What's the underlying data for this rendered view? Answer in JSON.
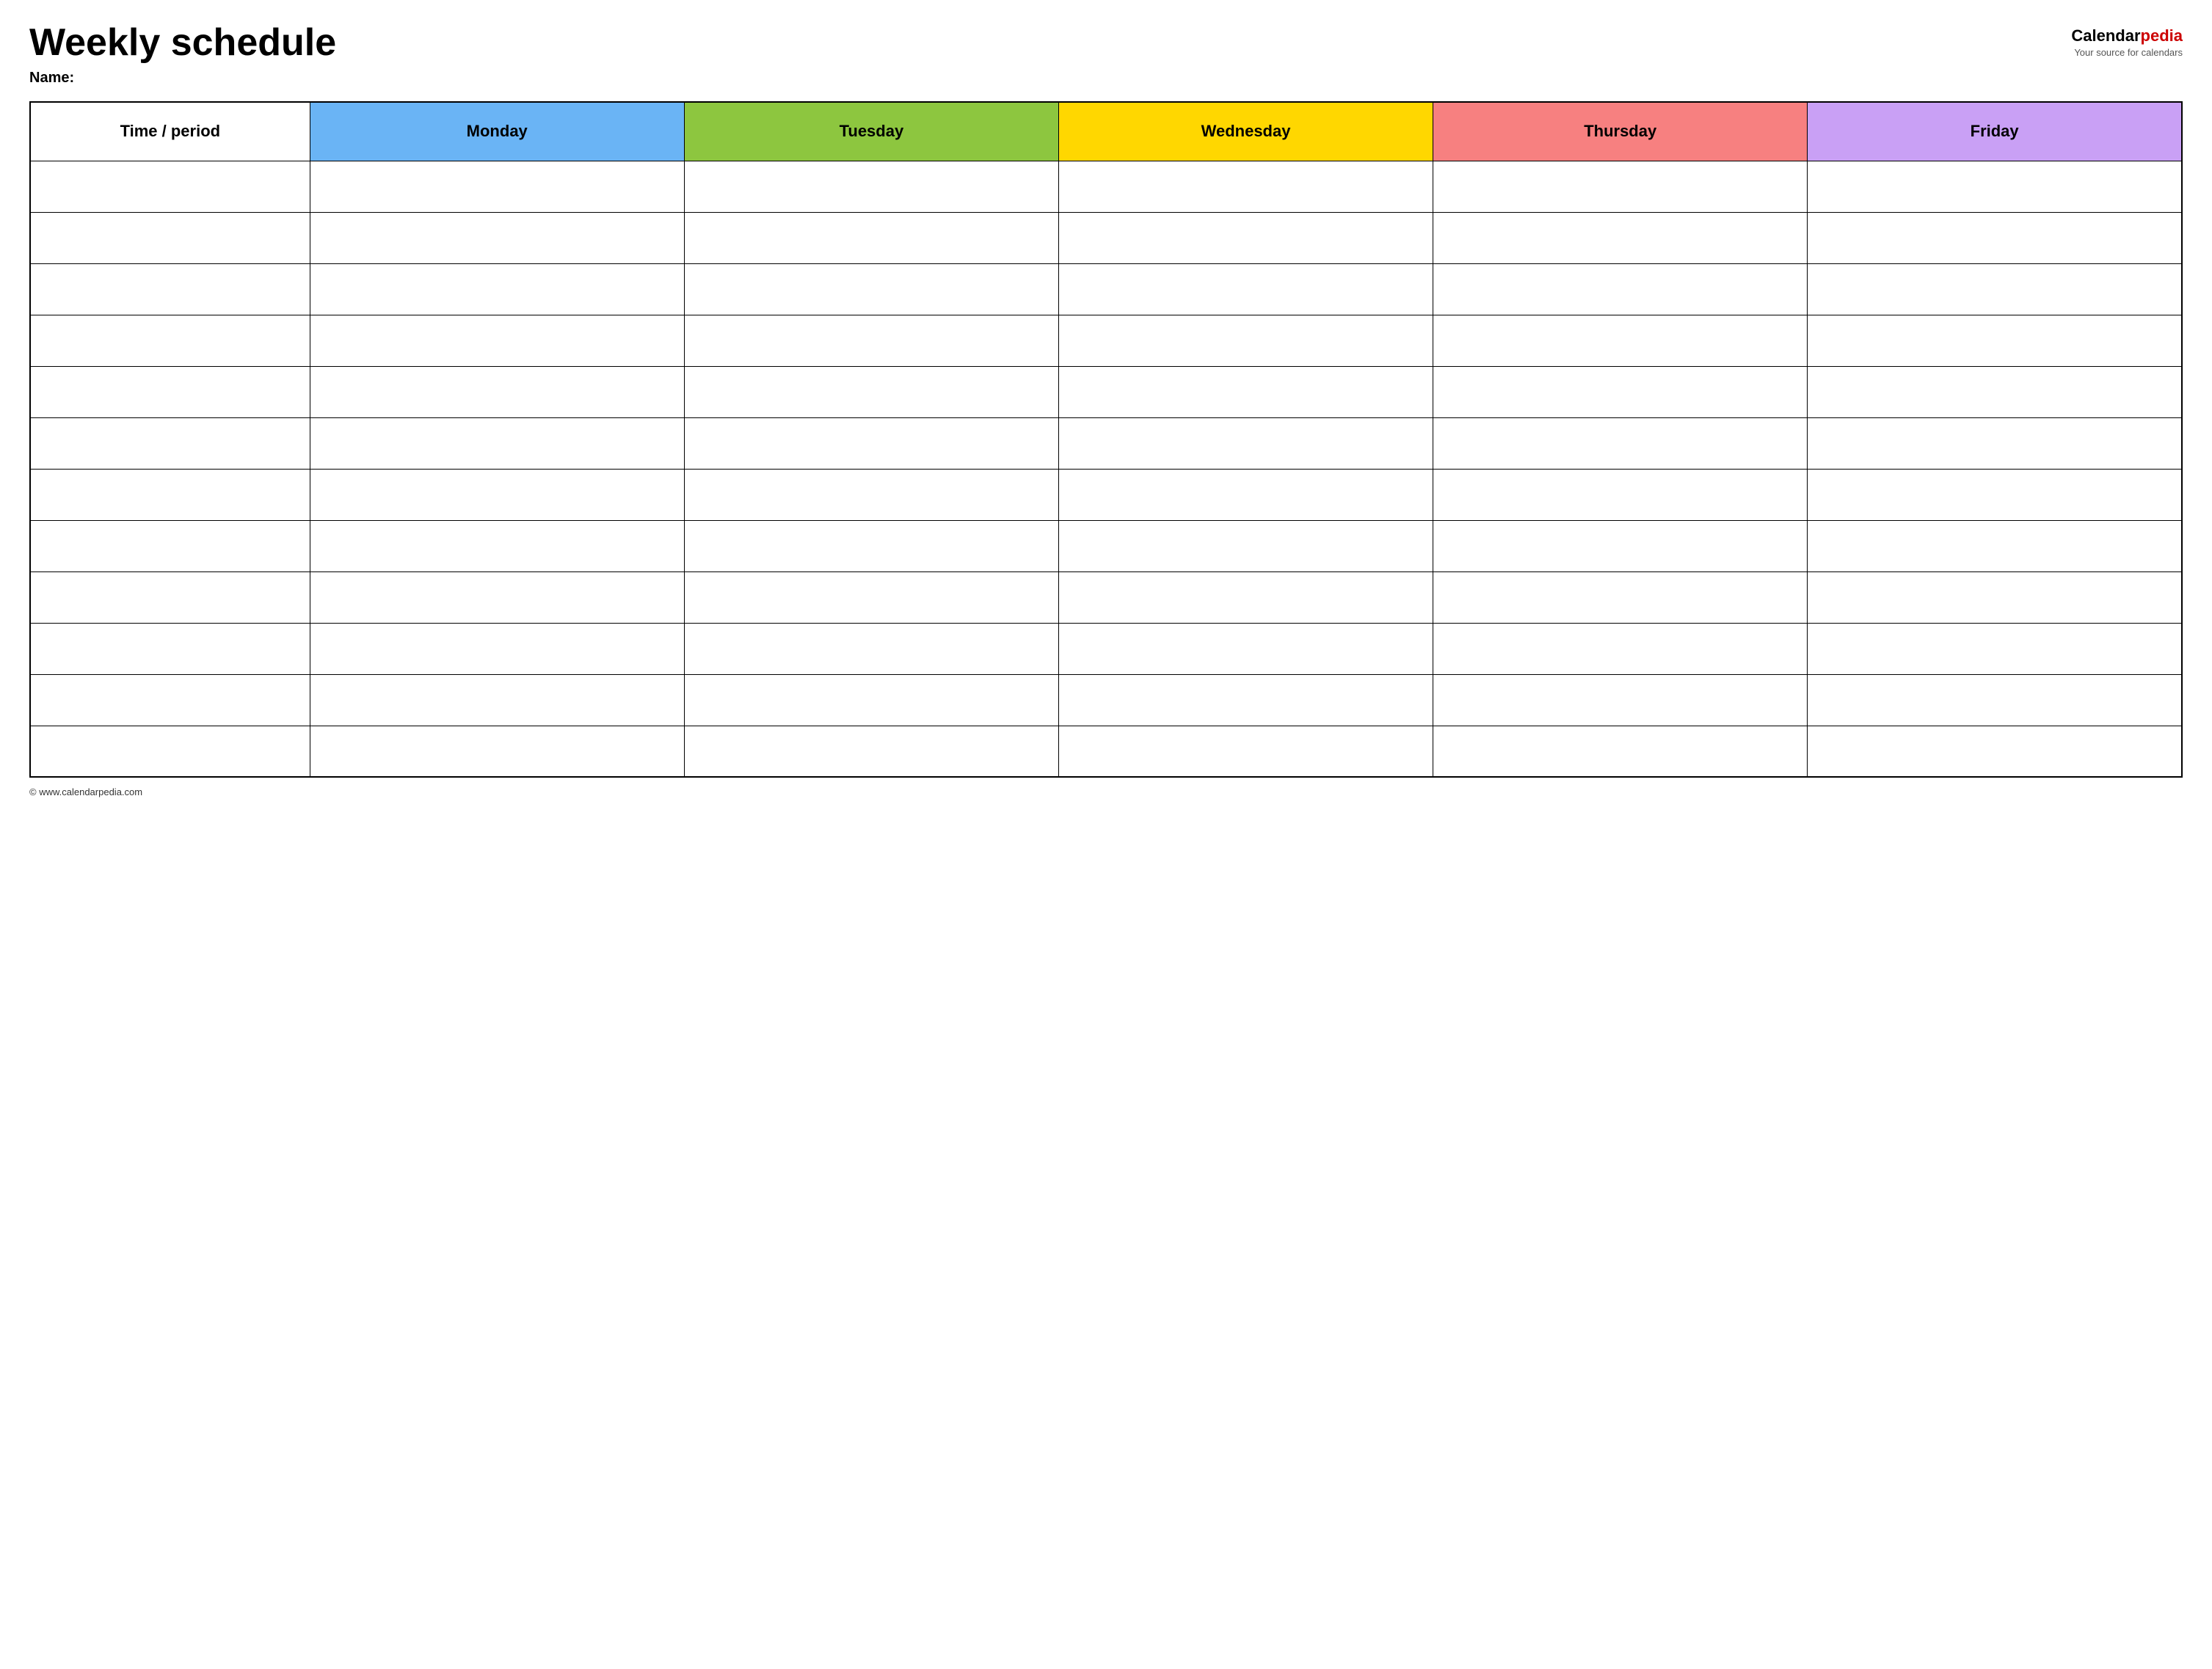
{
  "header": {
    "title": "Weekly schedule",
    "name_label": "Name:",
    "logo": {
      "calendar_part": "Calendar",
      "pedia_part": "pedia",
      "tagline": "Your source for calendars"
    }
  },
  "table": {
    "columns": [
      {
        "id": "time",
        "label": "Time / period",
        "color": "#ffffff"
      },
      {
        "id": "monday",
        "label": "Monday",
        "color": "#6ab4f5"
      },
      {
        "id": "tuesday",
        "label": "Tuesday",
        "color": "#8dc63f"
      },
      {
        "id": "wednesday",
        "label": "Wednesday",
        "color": "#ffd700"
      },
      {
        "id": "thursday",
        "label": "Thursday",
        "color": "#f78080"
      },
      {
        "id": "friday",
        "label": "Friday",
        "color": "#c9a0f5"
      }
    ],
    "row_count": 12
  },
  "footer": {
    "copyright": "© www.calendarpedia.com"
  }
}
